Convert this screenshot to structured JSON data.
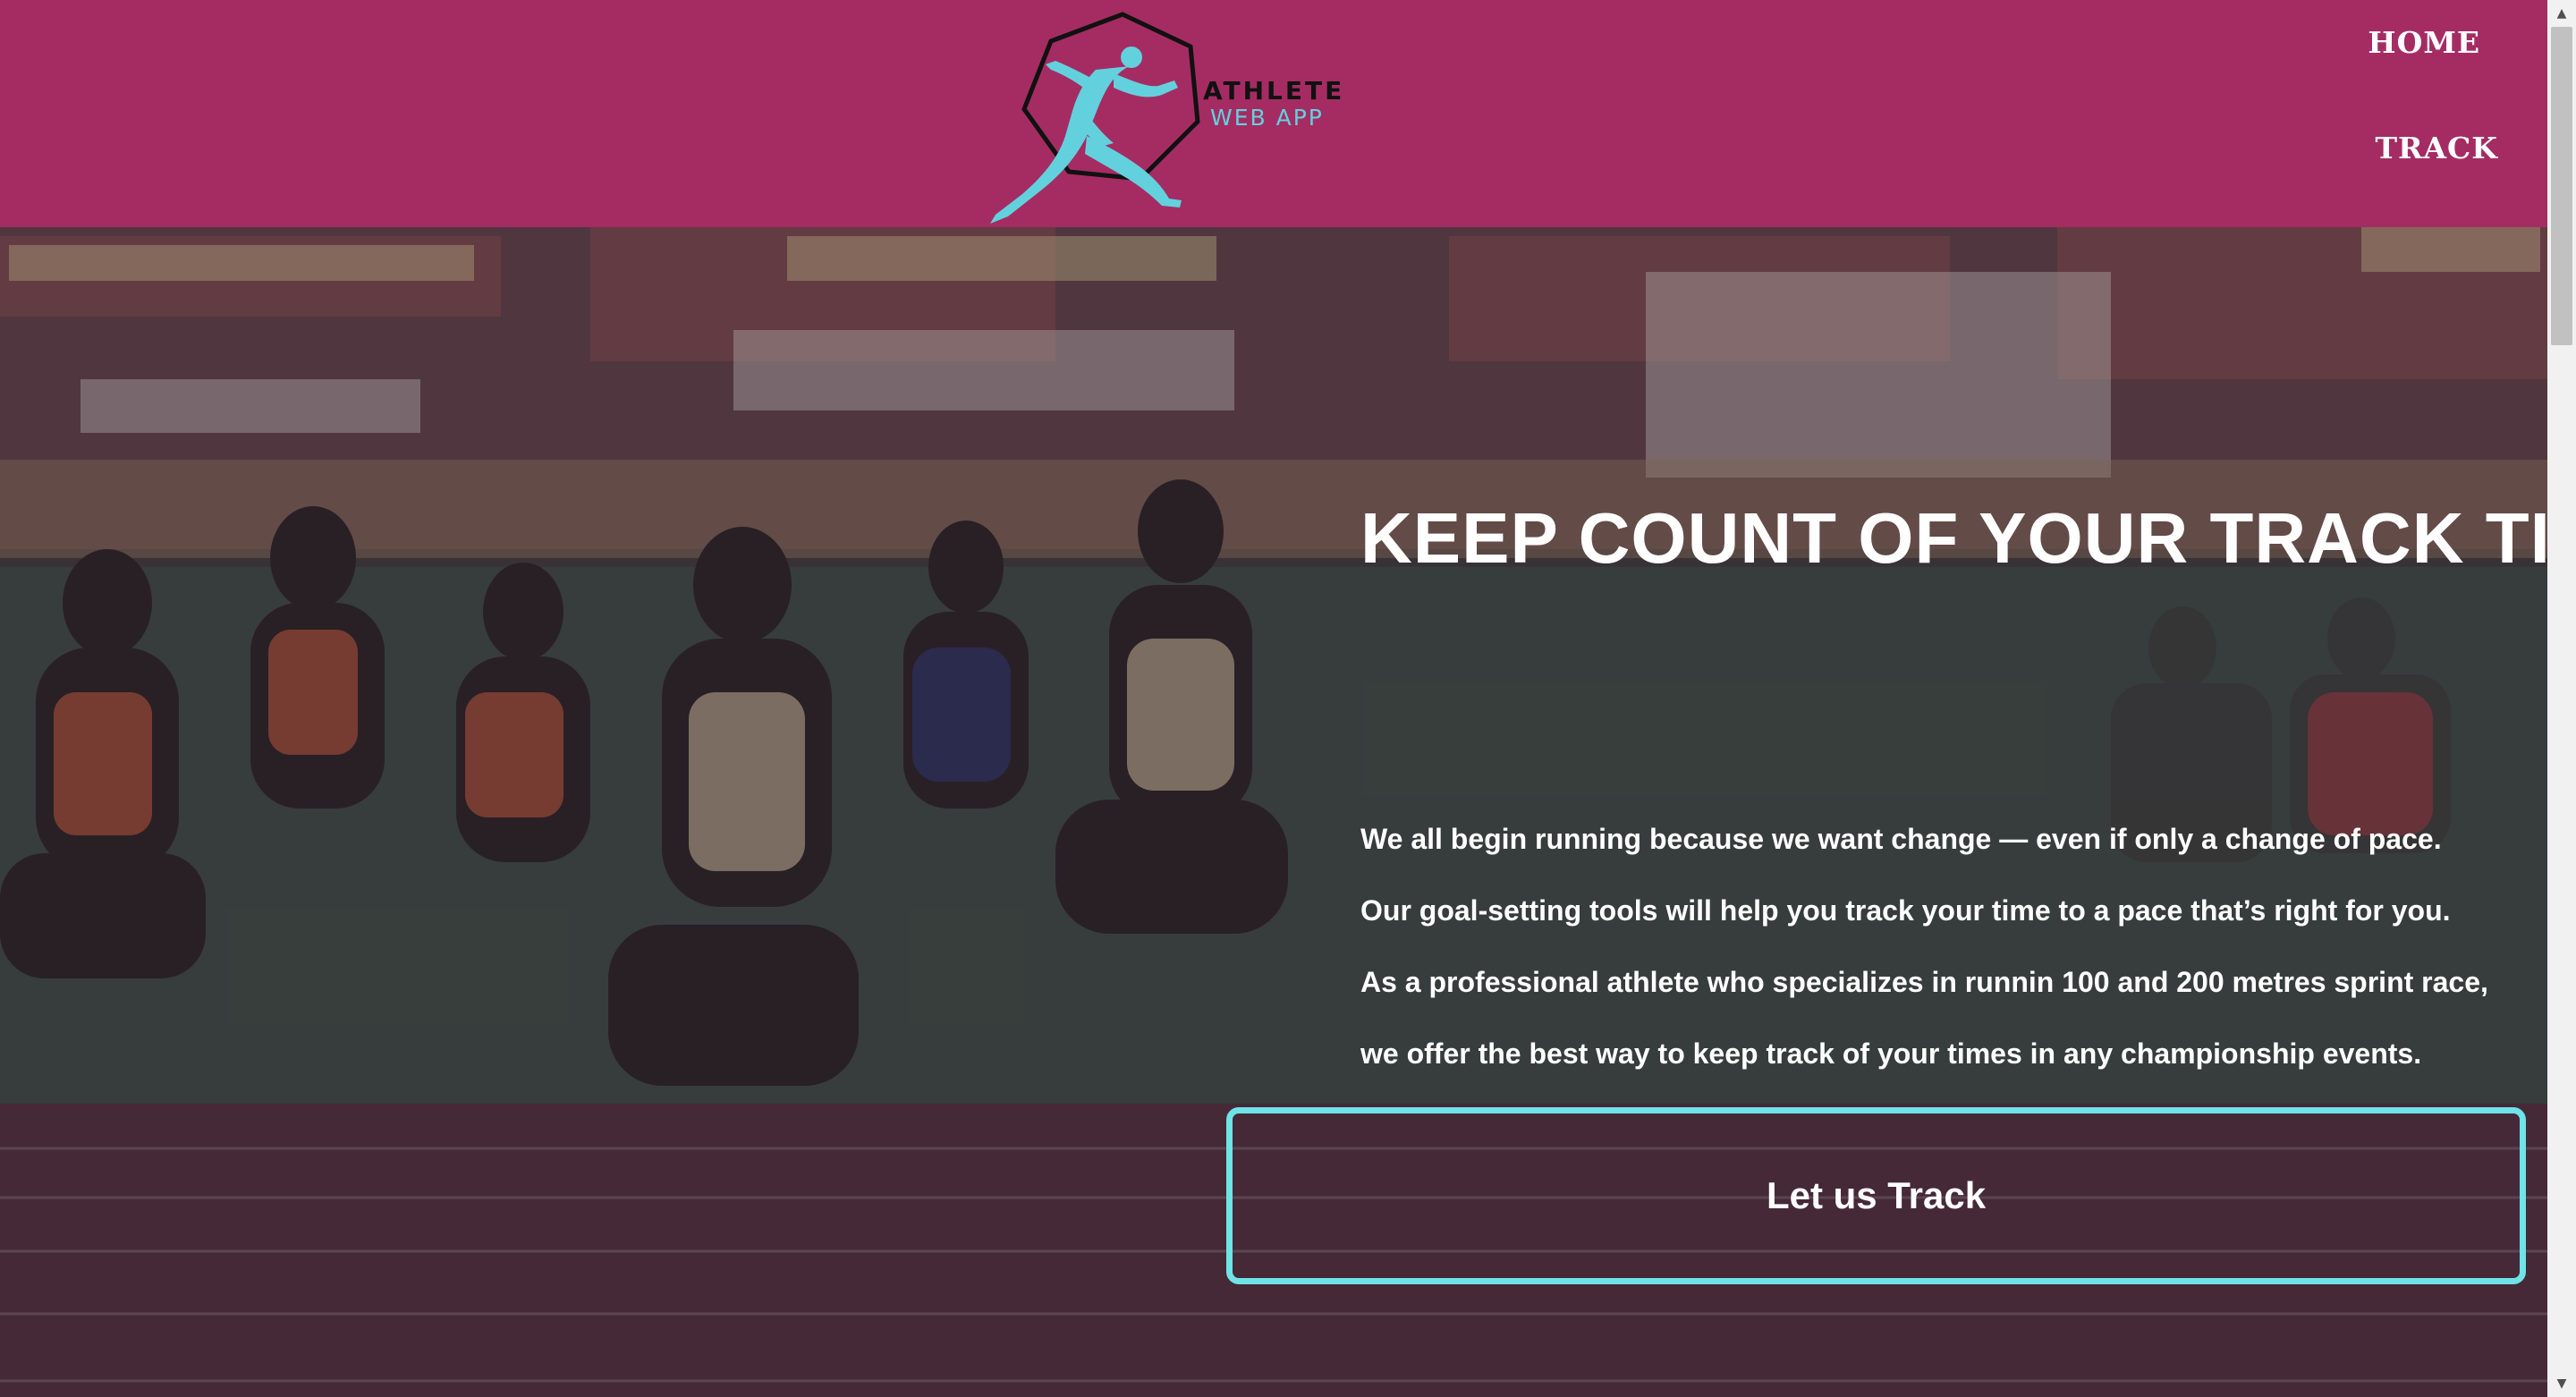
{
  "header": {
    "logo_line1": "ATHLETE",
    "logo_line2": "WEB APP",
    "nav": {
      "home": "HOME",
      "track": "TRACK"
    }
  },
  "hero": {
    "title": "KEEP COUNT OF YOUR TRACK TIME!",
    "lines": [
      "We all begin running because we want change — even if only a change of pace.",
      "Our goal-setting tools will help you track your time to a pace that’s right for you.",
      "As a professional athlete who specializes in runnin 100 and 200 metres sprint race,",
      "we offer the best way to keep track of your times in any championship events."
    ],
    "cta_label": "Let us Track",
    "background_image": "runners-sprinting-on-track"
  },
  "colors": {
    "header_bg": "#a52c63",
    "accent_cyan": "#62d1dd",
    "cta_border": "#6ee3e8",
    "text_white": "#ffffff"
  },
  "icons": {
    "logo": "runner-hexagon-icon",
    "scroll_up": "scroll-up-arrow-icon",
    "scroll_down": "scroll-down-arrow-icon"
  }
}
